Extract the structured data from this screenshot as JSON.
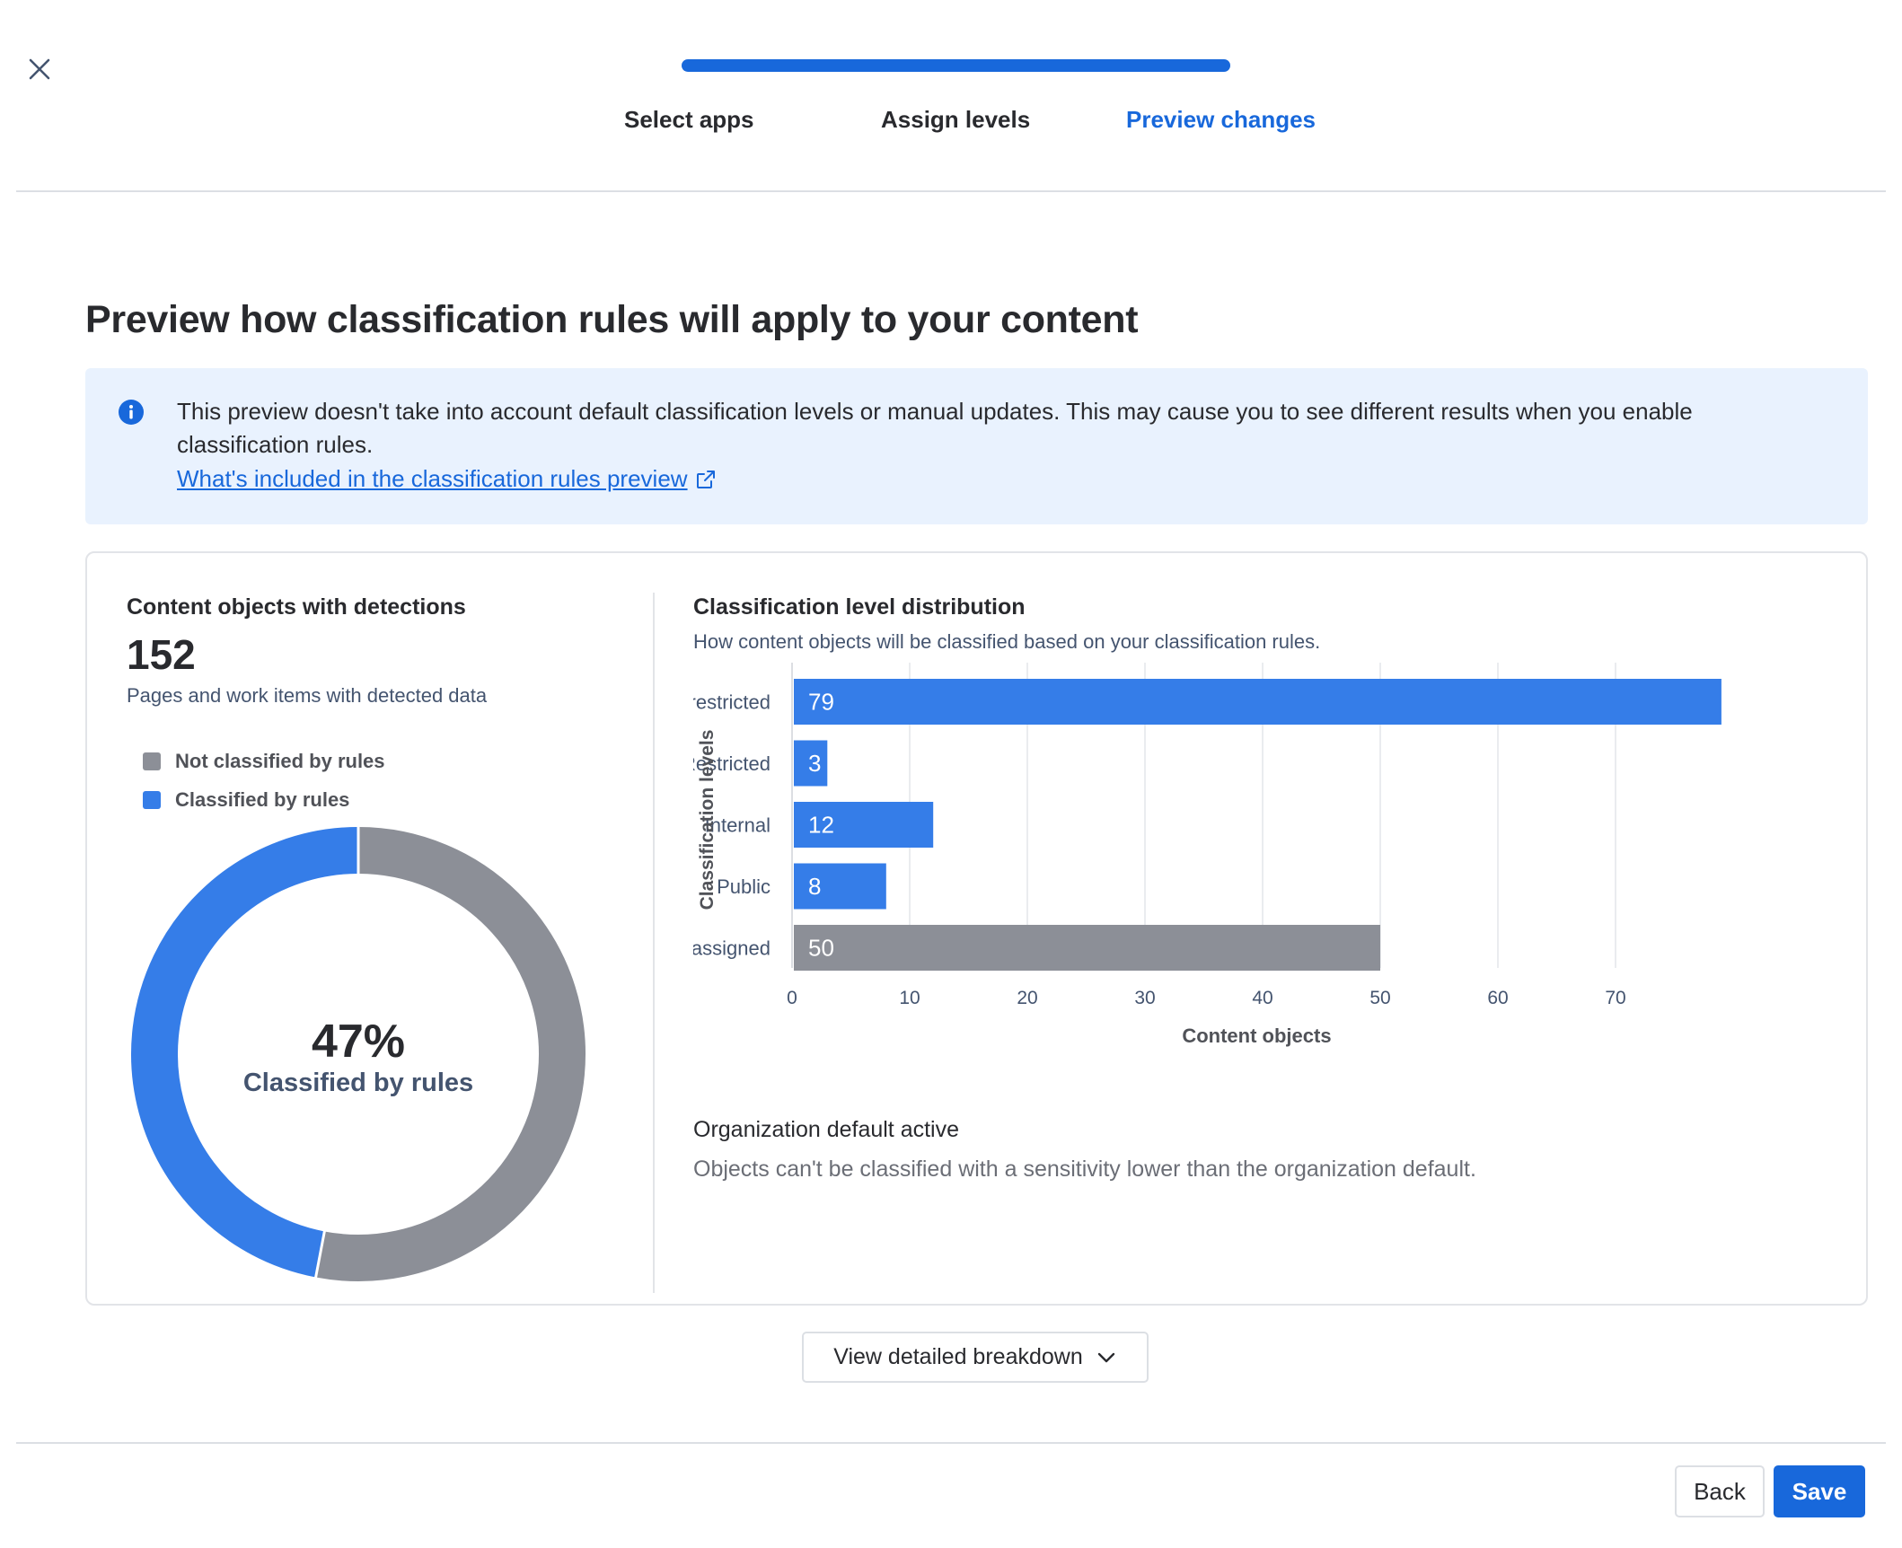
{
  "header": {
    "close_icon": "close-icon",
    "steps": [
      {
        "label": "Select apps",
        "active": false
      },
      {
        "label": "Assign levels",
        "active": false
      },
      {
        "label": "Preview changes",
        "active": true
      }
    ]
  },
  "page_title": "Preview how classification rules will apply to your content",
  "info_banner": {
    "icon": "info-icon",
    "text": "This preview doesn't take into account default classification levels or manual updates. This may cause you to see different results when you enable classification rules.",
    "link_text": "What's included in the classification rules preview",
    "link_icon": "external-link-icon"
  },
  "detections": {
    "title": "Content objects with detections",
    "count": "152",
    "subtitle": "Pages and work items with detected data",
    "legend": [
      {
        "label": "Not classified by rules",
        "color": "#8c8f97"
      },
      {
        "label": "Classified by rules",
        "color": "#357de8"
      }
    ],
    "donut_percent": "47%",
    "donut_label": "Classified by rules"
  },
  "distribution": {
    "title": "Classification level distribution",
    "subtitle": "How content objects will be classified based on your classification rules."
  },
  "chart_data": [
    {
      "type": "pie",
      "categories": [
        "Not classified by rules",
        "Classified by rules"
      ],
      "values": [
        53,
        47
      ],
      "colors": [
        "#8c8f97",
        "#357de8"
      ],
      "donut": true
    },
    {
      "type": "bar",
      "orientation": "horizontal",
      "categories": [
        "Highly restricted",
        "Restricted",
        "Internal",
        "Public",
        "Not assigned"
      ],
      "values": [
        79,
        3,
        12,
        8,
        50
      ],
      "colors": [
        "#357de8",
        "#357de8",
        "#357de8",
        "#357de8",
        "#8c8f97"
      ],
      "xlabel": "Content objects",
      "ylabel": "Classification levels",
      "xticks": [
        0,
        10,
        20,
        30,
        40,
        50,
        60,
        70
      ],
      "xlim": [
        0,
        79
      ],
      "grid": true
    }
  ],
  "org_default": {
    "title": "Organization default active",
    "subtitle": "Objects can't be classified with a sensitivity lower than the organization default."
  },
  "breakdown_button": {
    "label": "View detailed breakdown",
    "icon": "chevron-down-icon"
  },
  "footer": {
    "back_label": "Back",
    "save_label": "Save"
  }
}
